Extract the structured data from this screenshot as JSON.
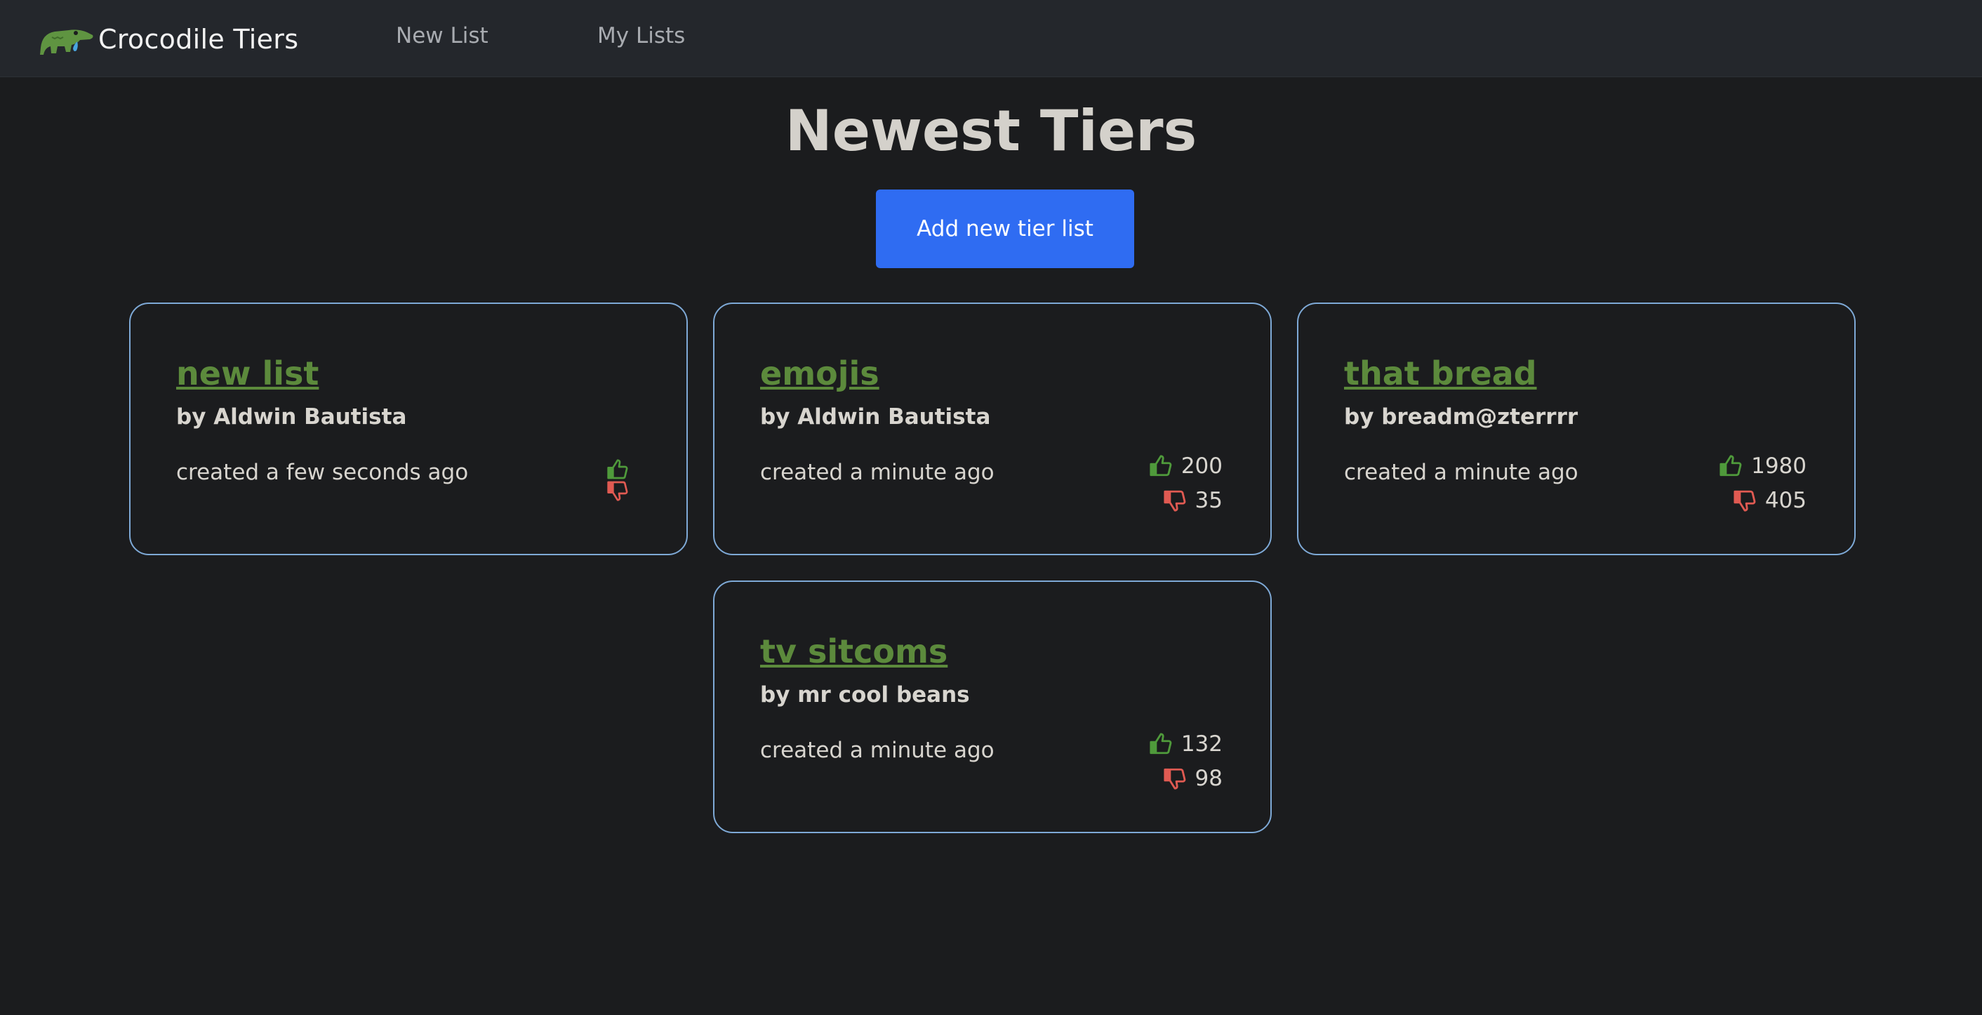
{
  "nav": {
    "brand": "Crocodile Tiers",
    "links": [
      "New List",
      "My Lists"
    ]
  },
  "page": {
    "title": "Newest Tiers",
    "add_button": "Add new tier list"
  },
  "lists": [
    {
      "title": "new list",
      "author": "by Aldwin Bautista",
      "created": "created a few seconds ago",
      "upvotes": "",
      "downvotes": ""
    },
    {
      "title": "emojis",
      "author": "by Aldwin Bautista",
      "created": "created a minute ago",
      "upvotes": "200",
      "downvotes": "35"
    },
    {
      "title": "that bread",
      "author": "by breadm@zterrrr",
      "created": "created a minute ago",
      "upvotes": "1980",
      "downvotes": "405"
    },
    {
      "title": "tv sitcoms",
      "author": "by mr cool beans",
      "created": "created a minute ago",
      "upvotes": "132",
      "downvotes": "98"
    }
  ],
  "colors": {
    "background": "#1b1c1e",
    "navbar": "#24272c",
    "accent_button": "#2f6cf2",
    "card_border": "#7ea9d6",
    "title_green": "#5c8a3c",
    "upvote": "#4f9a3b",
    "downvote": "#e05a52"
  },
  "icons": [
    "crocodile-logo-icon",
    "thumbs-up-icon",
    "thumbs-down-icon"
  ]
}
